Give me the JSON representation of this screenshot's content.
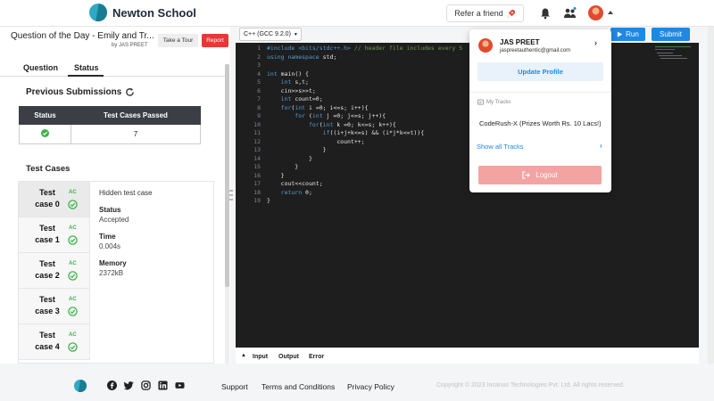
{
  "header": {
    "brand": "Newton School",
    "refer_label": "Refer a friend"
  },
  "question": {
    "title": "Question of the Day - Emily and Tr...",
    "author": "by JAS PREET",
    "tour_label": "Take a Tour",
    "report_label": "Report",
    "tabs": [
      {
        "label": "Question"
      },
      {
        "label": "Status"
      }
    ]
  },
  "submissions": {
    "title": "Previous Submissions",
    "columns": [
      "Status",
      "Test Cases Passed"
    ],
    "rows": [
      {
        "passed": "7"
      }
    ]
  },
  "testcases": {
    "title": "Test Cases",
    "ac": "AC",
    "items": [
      {
        "label": "Test case 0"
      },
      {
        "label": "Test case 1"
      },
      {
        "label": "Test case 2"
      },
      {
        "label": "Test case 3"
      },
      {
        "label": "Test case 4"
      }
    ],
    "detail": {
      "heading": "Hidden test case",
      "status_key": "Status",
      "status_val": "Accepted",
      "time_key": "Time",
      "time_val": "0.004s",
      "memory_key": "Memory",
      "memory_val": "2372kB"
    }
  },
  "editor": {
    "language": "C++ (GCC 9.2.0)",
    "run_label": "Run",
    "submit_label": "Submit",
    "line_numbers": [
      "1",
      "2",
      "3",
      "4",
      "5",
      "6",
      "7",
      "8",
      "9",
      "10",
      "11",
      "12",
      "13",
      "14",
      "15",
      "16",
      "17",
      "18",
      "19"
    ],
    "code": {
      "l1a": "#include <bits/stdc++.h> ",
      "l1b": "// header file includes every S",
      "l2a": "using namespace",
      "l2b": " std;",
      "l3": "",
      "l4a": "int",
      "l4b": " main() {",
      "l5a": "    int",
      "l5b": " s,t;",
      "l6": "    cin>>s>>t;",
      "l7a": "    int",
      "l7b": " count=0;",
      "l8a": "    for",
      "l8b": "(",
      "l8c": "int",
      "l8d": " i =0; i<=s; i++){",
      "l9a": "        for",
      "l9b": " (",
      "l9c": "int",
      "l9d": " j =0; j<=s; j++){",
      "l10a": "            for",
      "l10b": "(",
      "l10c": "int",
      "l10d": " k =0; k<=s; k++){",
      "l11a": "                if",
      "l11b": "((i+j+k<=s) && (i*j*k<=t)){",
      "l12": "                    count++;",
      "l13": "                }",
      "l14": "            }",
      "l15": "        }",
      "l16": "    }",
      "l17": "    cout<<count;",
      "l18a": "    return",
      "l18b": " 0;",
      "l19": "}"
    },
    "io_tabs": [
      "Input",
      "Output",
      "Error"
    ]
  },
  "dropdown": {
    "name": "JAS PREET",
    "email": "jaspreetauthentic@gmail.com",
    "update_label": "Update Profile",
    "my_tracks": "My Tracks",
    "track": "CodeRush-X (Prizes Worth Rs. 10 Lacs!)",
    "show_all": "Show all Tracks",
    "logout": "Logout"
  },
  "footer": {
    "links": [
      "Support",
      "Terms and Conditions",
      "Privacy Policy"
    ],
    "copyright": "Copyright © 2023 Incanus Technologies Pvt. Ltd. All rights reserved."
  },
  "colors": {
    "primary": "#1e88e5",
    "danger": "#e53935",
    "success": "#3bb34a",
    "editor_bg": "#1e1e1e",
    "logout_bg": "#f4a3a3"
  },
  "icons": [
    "rocket-icon",
    "bell-icon",
    "community-icon",
    "refresh-icon",
    "check-circle-icon",
    "play-icon",
    "logout-icon",
    "track-icon",
    "facebook-icon",
    "twitter-icon",
    "instagram-icon",
    "linkedin-icon",
    "youtube-icon"
  ]
}
